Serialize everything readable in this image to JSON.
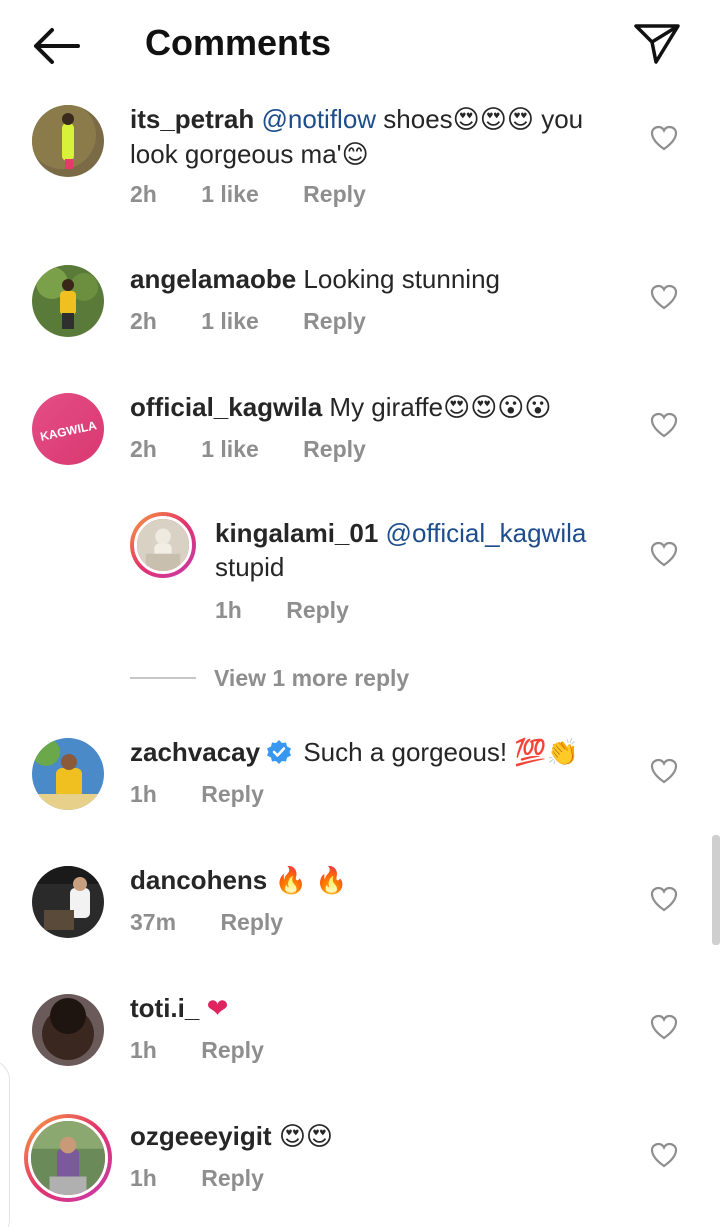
{
  "header": {
    "title": "Comments",
    "back_icon": "arrow-left-icon",
    "send_icon": "paper-plane-icon"
  },
  "comments": [
    {
      "user": "its_petrah",
      "mention": "@notiflow",
      "text_a": " shoes",
      "emoji_a": "😍😍😍",
      "text_b": " you look gorgeous ma'",
      "emoji_b": "😊",
      "time": "2h",
      "likes": "1 like",
      "reply": "Reply"
    },
    {
      "user": "angelamaobe",
      "text": " Looking stunning",
      "time": "2h",
      "likes": "1 like",
      "reply": "Reply"
    },
    {
      "user": "official_kagwila",
      "text": " My giraffe",
      "emoji": "😍😍😮😮",
      "time": "2h",
      "likes": "1 like",
      "reply": "Reply",
      "avatar_text": "KAGWILA"
    },
    {
      "user": "kingalami_01",
      "mention": "@official_kagwila",
      "text": "stupid",
      "time": "1h",
      "reply": "Reply"
    },
    {
      "user": "zachvacay",
      "text": " Such a gorgeous! ",
      "emoji": "💯👏",
      "time": "1h",
      "reply": "Reply"
    },
    {
      "user": "dancohens",
      "emoji": "🔥 🔥",
      "time": "37m",
      "reply": "Reply"
    },
    {
      "user": "toti.i_",
      "emoji": "❤",
      "time": "1h",
      "reply": "Reply"
    },
    {
      "user": "ozgeeeyigit",
      "emoji": "😍😍",
      "time": "1h",
      "reply": "Reply"
    }
  ],
  "view_more": "View 1 more reply",
  "colors": {
    "mention": "#1e4d8c",
    "muted": "#8e8e8e",
    "verified": "#3897f0",
    "heart_red": "#e0245e"
  }
}
